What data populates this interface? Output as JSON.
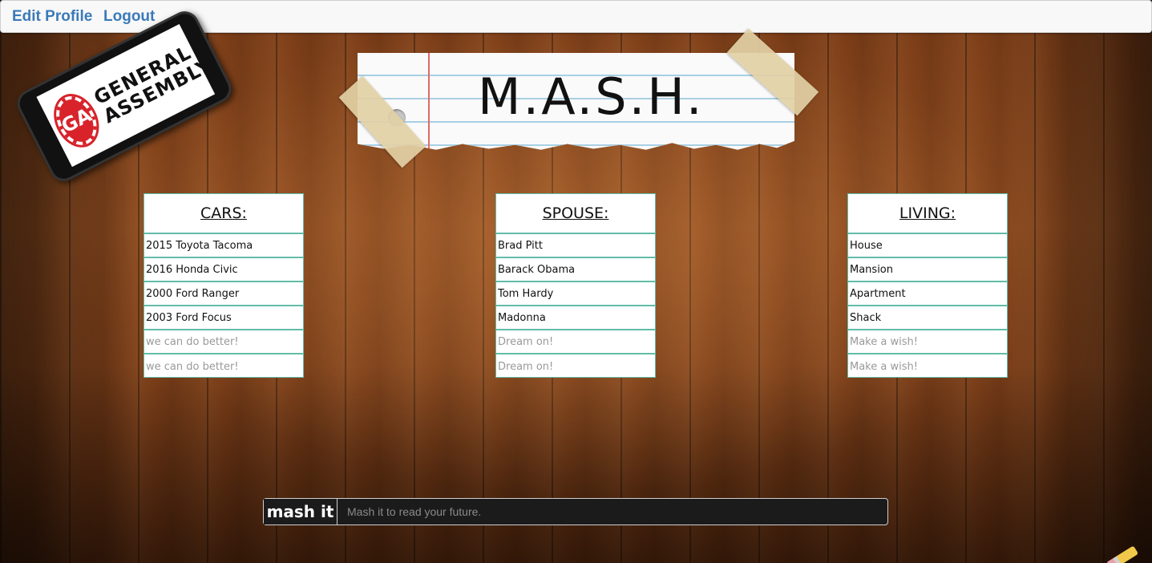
{
  "nav": {
    "edit_profile": "Edit Profile",
    "logout": "Logout"
  },
  "logo": {
    "badge": "GA",
    "line1": "GENERAL",
    "line2": "ASSEMBLY"
  },
  "title": "M.A.S.H.",
  "categories": {
    "cars": {
      "heading": "CARS:",
      "items": [
        "2015 Toyota Tacoma",
        "2016 Honda Civic",
        "2000 Ford Ranger",
        "2003 Ford Focus"
      ],
      "placeholder": "we can do better!"
    },
    "spouse": {
      "heading": "SPOUSE:",
      "items": [
        "Brad Pitt",
        "Barack Obama",
        "Tom Hardy",
        "Madonna"
      ],
      "placeholder": "Dream on!"
    },
    "living": {
      "heading": "LIVING:",
      "items": [
        "House",
        "Mansion",
        "Apartment",
        "Shack"
      ],
      "placeholder": "Make a wish!"
    }
  },
  "mash": {
    "button_label": "mash it",
    "input_placeholder": "Mash it to read your future.",
    "input_value": ""
  },
  "colors": {
    "nav_link": "#3a7ab8",
    "card_border": "#62bca8",
    "mash_bar": "#1b1b1b"
  },
  "icons": [
    "ga-logo-icon",
    "pencil-icon"
  ]
}
